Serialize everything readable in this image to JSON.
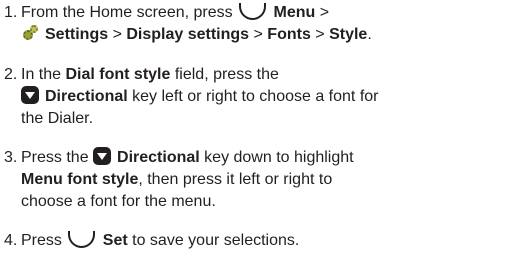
{
  "steps": [
    {
      "number": "1.",
      "parts": [
        {
          "type": "text",
          "value": "From the Home screen, press "
        },
        {
          "type": "icon",
          "icon": "softkey-icon"
        },
        {
          "type": "bold",
          "value": " Menu"
        },
        {
          "type": "text",
          "value": " >"
        },
        {
          "type": "break"
        },
        {
          "type": "icon",
          "icon": "settings-icon"
        },
        {
          "type": "bold",
          "value": "Settings"
        },
        {
          "type": "text",
          "value": " > "
        },
        {
          "type": "bold",
          "value": "Display settings"
        },
        {
          "type": "text",
          "value": " > "
        },
        {
          "type": "bold",
          "value": "Fonts"
        },
        {
          "type": "text",
          "value": " > "
        },
        {
          "type": "bold",
          "value": "Style"
        },
        {
          "type": "text",
          "value": "."
        }
      ]
    },
    {
      "number": "2.",
      "parts": [
        {
          "type": "text",
          "value": "In the "
        },
        {
          "type": "bold",
          "value": "Dial font style"
        },
        {
          "type": "text",
          "value": " field, press the"
        },
        {
          "type": "break"
        },
        {
          "type": "icon",
          "icon": "directional-key-icon"
        },
        {
          "type": "bold",
          "value": "Directional"
        },
        {
          "type": "text",
          "value": " key left or right to choose a font for"
        },
        {
          "type": "break"
        },
        {
          "type": "text",
          "value": "the Dialer."
        }
      ]
    },
    {
      "number": "3.",
      "parts": [
        {
          "type": "text",
          "value": "Press the "
        },
        {
          "type": "icon",
          "icon": "directional-key-icon"
        },
        {
          "type": "bold",
          "value": "Directional"
        },
        {
          "type": "text",
          "value": " key down to highlight"
        },
        {
          "type": "break"
        },
        {
          "type": "bold",
          "value": "Menu font style"
        },
        {
          "type": "text",
          "value": ", then press it left or right to"
        },
        {
          "type": "break"
        },
        {
          "type": "text",
          "value": "choose a font for the menu."
        }
      ]
    },
    {
      "number": "4.",
      "parts": [
        {
          "type": "text",
          "value": "Press "
        },
        {
          "type": "icon",
          "icon": "softkey-icon"
        },
        {
          "type": "bold",
          "value": " Set"
        },
        {
          "type": "text",
          "value": " to save your selections."
        }
      ]
    }
  ]
}
